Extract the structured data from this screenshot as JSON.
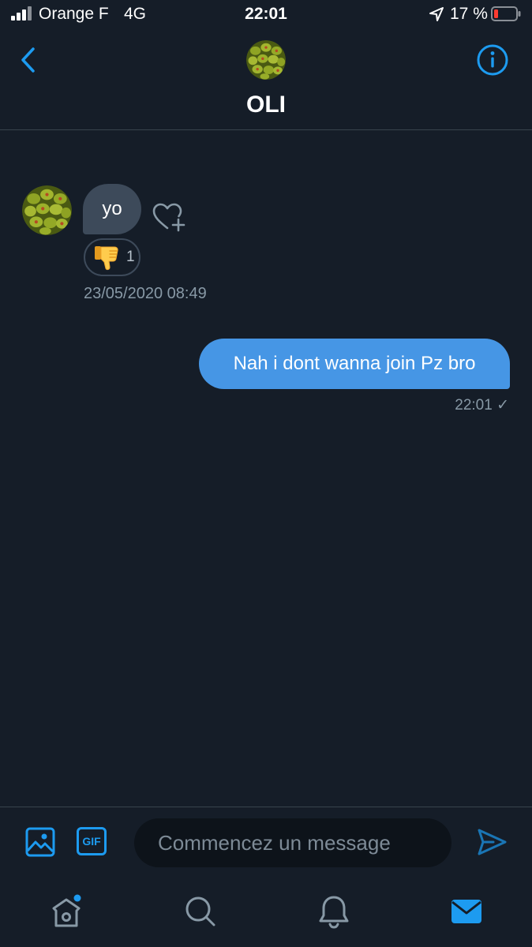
{
  "status_bar": {
    "carrier": "Orange F",
    "network": "4G",
    "time": "22:01",
    "battery_percent": "17 %"
  },
  "header": {
    "contact_name": "OLI",
    "back_icon": "chevron-left-icon",
    "info_icon": "info-icon"
  },
  "messages": [
    {
      "direction": "incoming",
      "text": "yo",
      "reaction": {
        "icon": "thumbs-down-emoji",
        "count": "1"
      },
      "timestamp": "23/05/2020 08:49"
    },
    {
      "direction": "outgoing",
      "text": "Nah i dont wanna join Pz bro",
      "timestamp": "22:01 ✓"
    }
  ],
  "composer": {
    "placeholder": "Commencez un message",
    "gif_label": "GIF"
  },
  "tab_bar": [
    "home-icon",
    "search-icon",
    "bell-icon",
    "mail-icon"
  ],
  "colors": {
    "background": "#151d28",
    "accent": "#1d9bf0",
    "outgoing_bubble": "#4696e5",
    "incoming_bubble": "#3d4a5a"
  }
}
